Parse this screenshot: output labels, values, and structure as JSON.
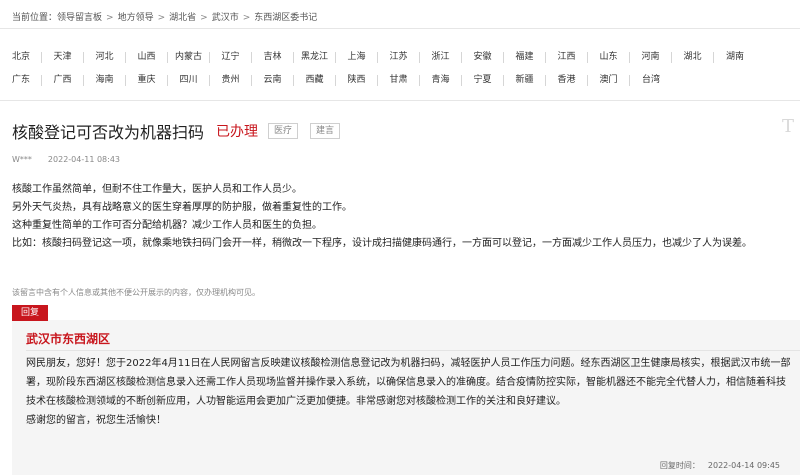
{
  "breadcrumb": {
    "prefix": "当前位置：",
    "items": [
      "领导留言板",
      "地方领导",
      "湖北省",
      "武汉市",
      "东西湖区委书记"
    ]
  },
  "regions": {
    "row1": [
      "北京",
      "天津",
      "河北",
      "山西",
      "内蒙古",
      "辽宁",
      "吉林",
      "黑龙江",
      "上海",
      "江苏",
      "浙江",
      "安徽",
      "福建",
      "江西",
      "山东",
      "河南",
      "湖北",
      "湖南"
    ],
    "row2": [
      "广东",
      "广西",
      "海南",
      "重庆",
      "四川",
      "贵州",
      "云南",
      "西藏",
      "陕西",
      "甘肃",
      "青海",
      "宁夏",
      "新疆",
      "香港",
      "澳门",
      "台湾"
    ]
  },
  "message": {
    "title": "核酸登记可否改为机器扫码",
    "status": "已办理",
    "tags": [
      "医疗",
      "建言"
    ],
    "corner_mark": "T",
    "author": "W***",
    "date": "2022-04-11 08:43",
    "paragraphs": [
      "核酸工作虽然简单，但耐不住工作量大，医护人员和工作人员少。",
      "另外天气炎热，具有战略意义的医生穿着厚厚的防护服，做着重复性的工作。",
      "这种重复性简单的工作可否分配给机器？减少工作人员和医生的负担。",
      "比如：核酸扫码登记这一项，就像乘地铁扫码门会开一样，稍微改一下程序，设计成扫描健康码通行，一方面可以登记，一方面减少工作人员压力，也减少了人为误差。"
    ],
    "privacy_note": "该留言中含有个人信息或其他不便公开展示的内容，仅办理机构可见。"
  },
  "reply": {
    "label": "回复",
    "org": "武汉市东西湖区",
    "body": "网民朋友，您好！您于2022年4月11日在人民网留言反映建议核酸检测信息登记改为机器扫码，减轻医护人员工作压力问题。经东西湖区卫生健康局核实，根据武汉市统一部署，现阶段东西湖区核酸检测信息录入还需工作人员现场监督并操作录入系统，以确保信息录入的准确度。结合疫情防控实际，智能机器还不能完全代替人力，相信随着科技技术在核酸检测领域的不断创新应用，人功智能运用会更加广泛更加便捷。非常感谢您对核酸检测工作的关注和良好建议。",
    "closing": "感谢您的留言，祝您生活愉快！",
    "time_label": "回复时间：",
    "time": "2022-04-14 09:45"
  },
  "colors": {
    "accent": "#c8161d",
    "reply_bg": "#f5f5f5"
  }
}
